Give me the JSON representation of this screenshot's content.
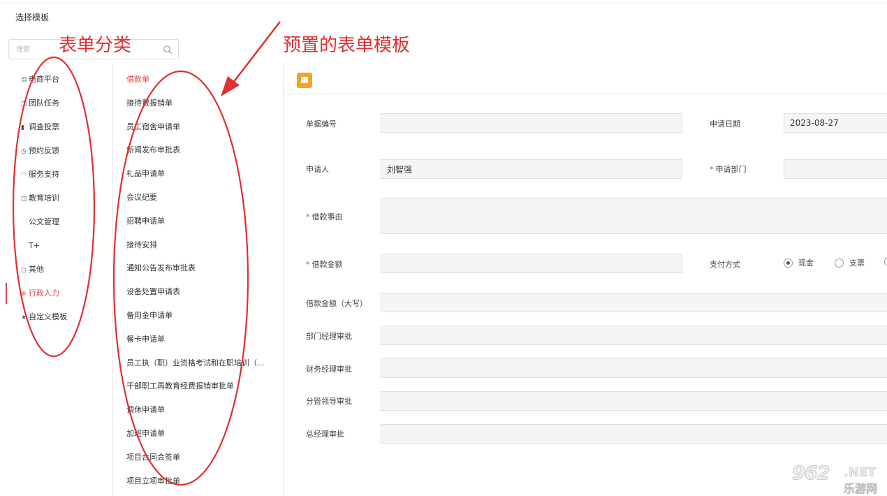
{
  "dialog": {
    "title": "选择模板"
  },
  "search": {
    "placeholder": "搜索"
  },
  "categories": [
    {
      "label": "电商平台",
      "icon": "☺"
    },
    {
      "label": "团队任务",
      "icon": "◫"
    },
    {
      "label": "调查投票",
      "icon": "▮"
    },
    {
      "label": "预约反馈",
      "icon": "◷"
    },
    {
      "label": "服务支持",
      "icon": "◠"
    },
    {
      "label": "教育培训",
      "icon": "◫"
    },
    {
      "label": "公文管理",
      "icon": ""
    },
    {
      "label": "T+",
      "icon": ""
    },
    {
      "label": "其他",
      "icon": "◻"
    },
    {
      "label": "行政人力",
      "icon": "⊛",
      "active": true
    },
    {
      "label": "自定义模板",
      "icon": "★"
    }
  ],
  "templates": [
    {
      "label": "借款单",
      "active": true
    },
    {
      "label": "接待费报销单"
    },
    {
      "label": "员工宿舍申请单"
    },
    {
      "label": "新闻发布审批表"
    },
    {
      "label": "礼品申请单"
    },
    {
      "label": "会议纪要"
    },
    {
      "label": "招聘申请单"
    },
    {
      "label": "接待安排"
    },
    {
      "label": "通知公告发布审批表"
    },
    {
      "label": "设备处置申请表"
    },
    {
      "label": "备用金申请单"
    },
    {
      "label": "餐卡申请单"
    },
    {
      "label": "员工执（职）业资格考试和在职培训（..."
    },
    {
      "label": "干部职工再教育经费报销审批单"
    },
    {
      "label": "调休申请单"
    },
    {
      "label": "加班申请单"
    },
    {
      "label": "项目合同会签单"
    },
    {
      "label": "项目立项审批单"
    }
  ],
  "form": {
    "doc_no_label": "单据编号",
    "apply_date_label": "申请日期",
    "apply_date_value": "2023-08-27",
    "applicant_label": "申请人",
    "applicant_value": "刘智强",
    "dept_label": "申请部门",
    "reason_label": "借款事由",
    "amount_label": "借款金额",
    "payment_label": "支付方式",
    "payment_options": [
      {
        "label": "现金",
        "selected": true
      },
      {
        "label": "支票",
        "selected": false
      }
    ],
    "amount_upper_label": "借款金额（大写）",
    "dept_mgr_label": "部门经理审批",
    "finance_mgr_label": "财务经理审批",
    "leader_label": "分管领导审批",
    "gm_label": "总经理审批",
    "required_mark": "*"
  },
  "annotations": {
    "category_label": "表单分类",
    "template_label": "预置的表单模板",
    "color": "#e03030"
  },
  "watermark": {
    "number": "962",
    "suffix": ".NET",
    "cn": "乐游网"
  },
  "colors": {
    "accent": "#e04545",
    "badge": "#f4a523"
  }
}
